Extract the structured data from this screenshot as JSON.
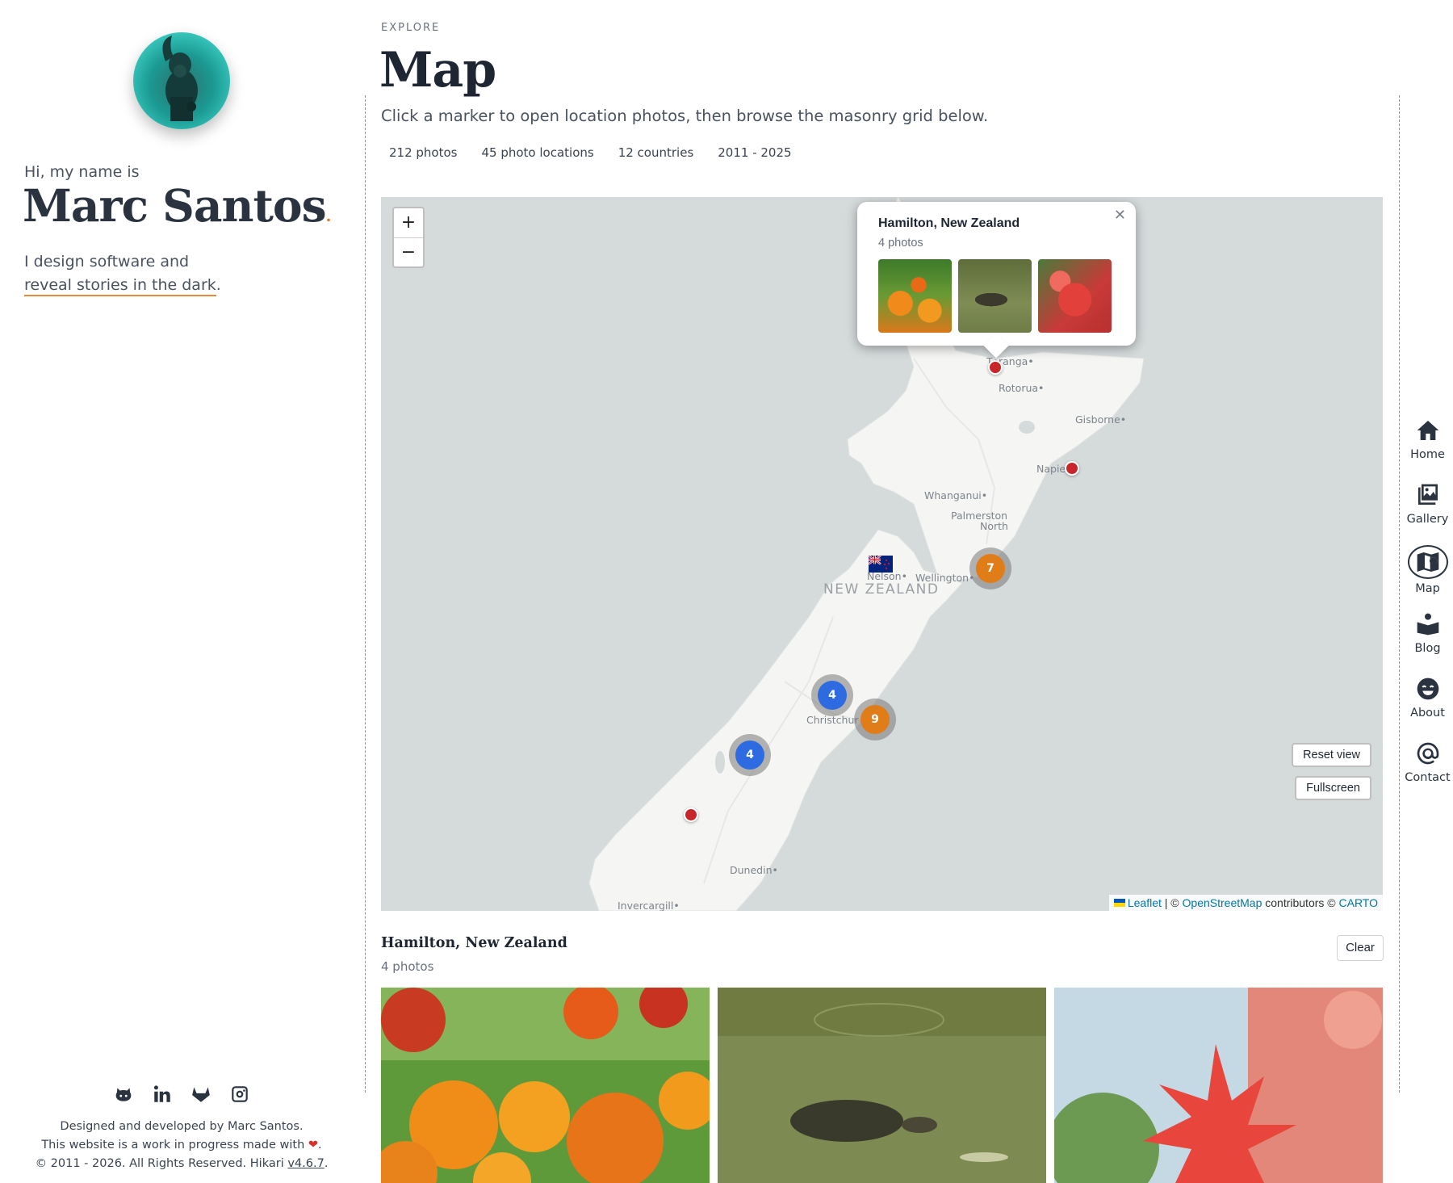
{
  "profile": {
    "greeting": "Hi, my name is",
    "name": "Marc Santos",
    "name_dot": ".",
    "tagline_line1": "I design software and",
    "tagline_link": "reveal stories in the dark",
    "tagline_end": "."
  },
  "socials": [
    {
      "icon": "github-icon"
    },
    {
      "icon": "linkedin-icon"
    },
    {
      "icon": "gitlab-icon"
    },
    {
      "icon": "instagram-icon"
    }
  ],
  "footer": {
    "line1": "Designed and developed by Marc Santos.",
    "line2": "This website is a work in progress made with",
    "line2_end": ".",
    "line3": "© 2011 - 2026. All Rights Reserved. Hikari",
    "version": "v4.6.7",
    "line3_end": "."
  },
  "header": {
    "eyebrow": "EXPLORE",
    "title": "Map",
    "subtitle": "Click a marker to open location photos, then browse the masonry grid below."
  },
  "stats": [
    "212 photos",
    "45 photo locations",
    "12 countries",
    "2011 - 2025"
  ],
  "map": {
    "zoom_in": "+",
    "zoom_out": "−",
    "country_label": "NEW ZEALAND",
    "places": [
      "T•ranga•",
      "Rotorua•",
      "Gisborne•",
      "Napie",
      "Whanganui•",
      "Palmerston",
      "North",
      "Nelson•",
      "Wellington•",
      "Christchur",
      "Dunedin•",
      "Invercargill•"
    ],
    "clusters": [
      {
        "count": "7",
        "color": "#e07d18"
      },
      {
        "count": "4",
        "color": "#2f6be0"
      },
      {
        "count": "9",
        "color": "#e07d18"
      },
      {
        "count": "4",
        "color": "#2f6be0"
      }
    ],
    "popup": {
      "title": "Hamilton, New Zealand",
      "count": "4 photos",
      "close": "✕"
    },
    "reset_button": "Reset view",
    "fullscreen_button": "Fullscreen",
    "attribution": {
      "leaflet": "Leaflet",
      "sep": "| ©",
      "osm": "OpenStreetMap",
      "contrib": "contributors ©",
      "carto": "CARTO"
    }
  },
  "selection": {
    "title": "Hamilton, New Zealand",
    "count": "4 photos",
    "clear": "Clear"
  },
  "nav": [
    {
      "label": "Home",
      "icon": "home-icon"
    },
    {
      "label": "Gallery",
      "icon": "gallery-icon"
    },
    {
      "label": "Map",
      "icon": "map-icon",
      "active": true
    },
    {
      "label": "Blog",
      "icon": "blog-icon"
    },
    {
      "label": "About",
      "icon": "about-icon"
    },
    {
      "label": "Contact",
      "icon": "at-icon"
    }
  ]
}
